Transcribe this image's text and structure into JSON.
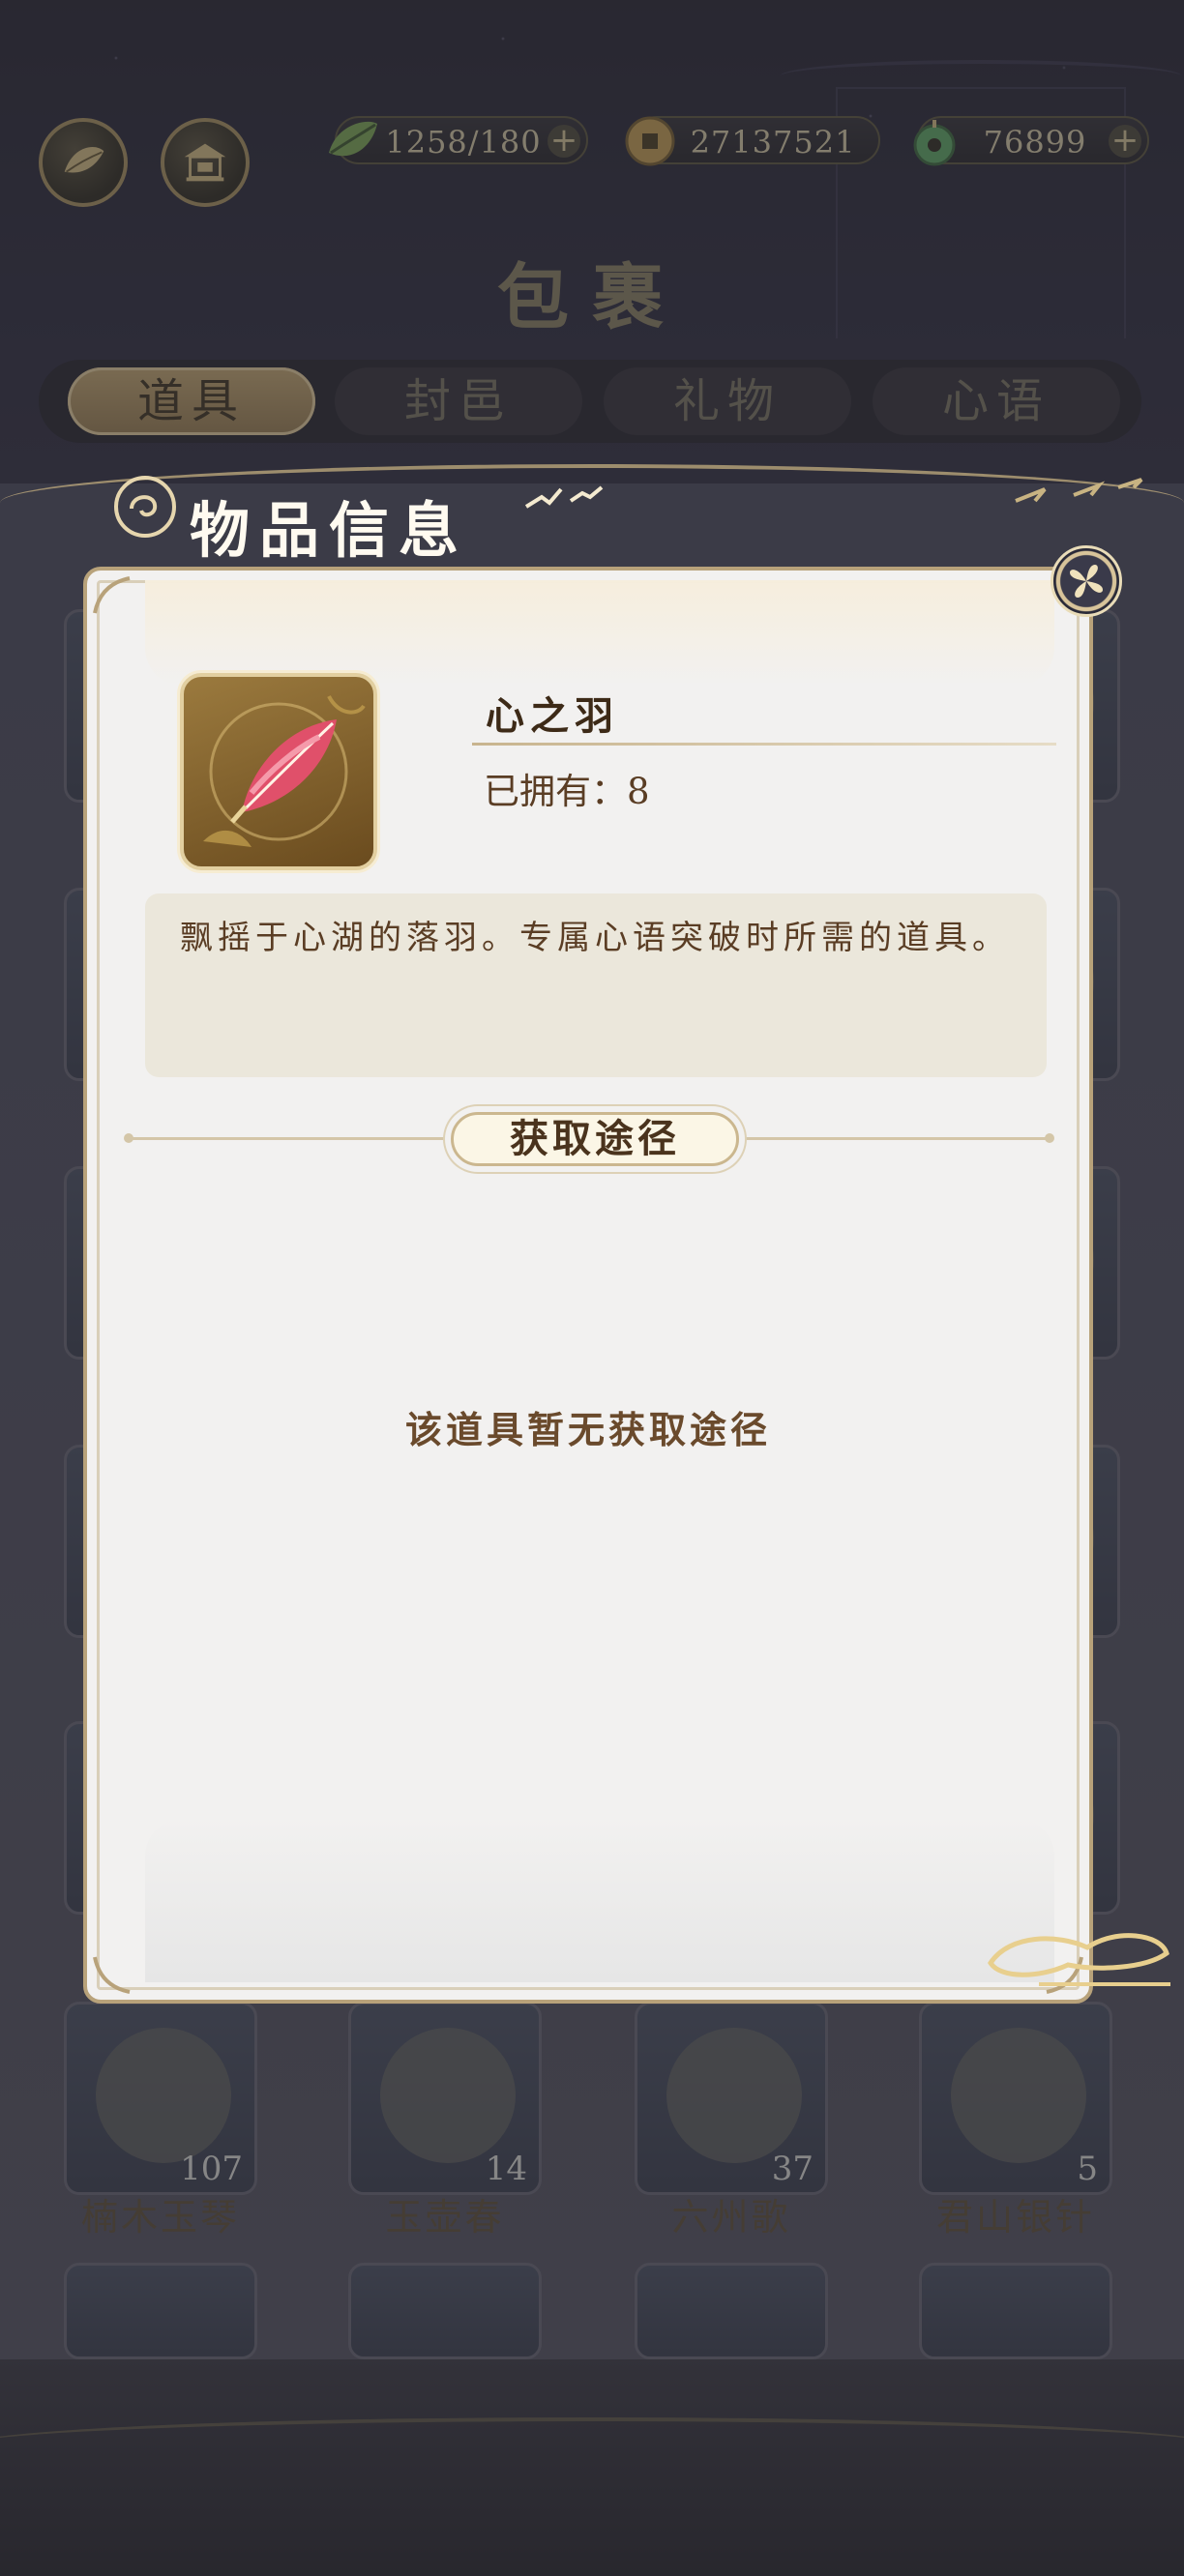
{
  "topbar": {
    "stamina": {
      "value": "1258/180",
      "plus": "+"
    },
    "coins": {
      "value": "27137521"
    },
    "jade": {
      "value": "76899",
      "plus": "+"
    }
  },
  "page_title": "包裹",
  "tabs": [
    {
      "label": "道具",
      "active": true
    },
    {
      "label": "封邑",
      "active": false
    },
    {
      "label": "礼物",
      "active": false
    },
    {
      "label": "心语",
      "active": false
    }
  ],
  "background_items": [
    {
      "name": "楠木玉琴",
      "count": "107"
    },
    {
      "name": "玉壶春",
      "count": "14"
    },
    {
      "name": "六州歌",
      "count": "37"
    },
    {
      "name": "君山银针",
      "count": "5"
    }
  ],
  "modal": {
    "header": "物品信息",
    "item_name": "心之羽",
    "owned_label": "已拥有：",
    "owned_count": "8",
    "description": "飘摇于心湖的落羽。专属心语突破时所需的道具。",
    "route_title": "获取途径",
    "no_route": "该道具暂无获取途径"
  },
  "colors": {
    "accent_gold": "#b8a27a",
    "text_brown": "#5a3d24",
    "modal_bg": "#f2f1f0"
  }
}
